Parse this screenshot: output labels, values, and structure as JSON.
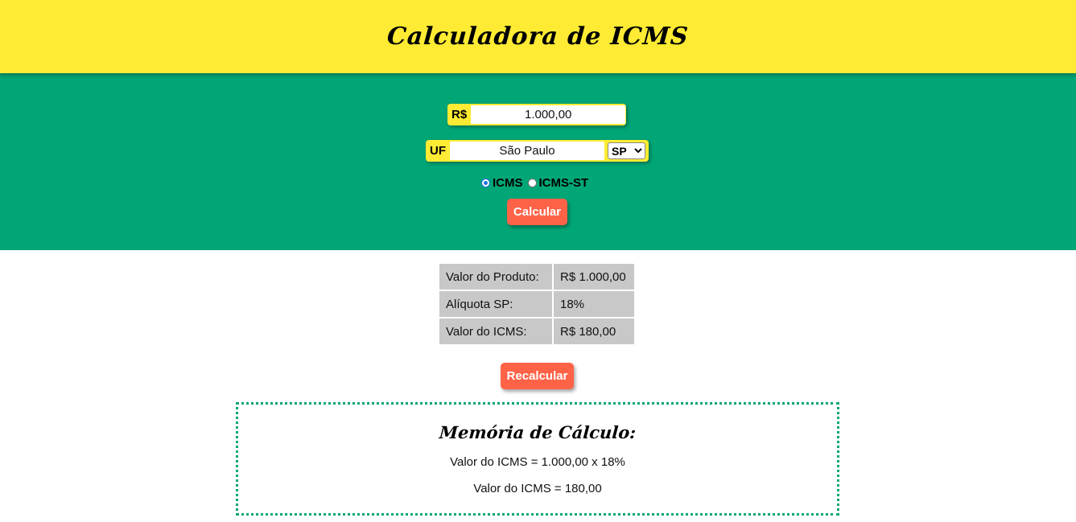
{
  "header": {
    "title": "Calculadora de ICMS"
  },
  "form": {
    "value_prefix": "R$",
    "value": "1.000,00",
    "uf_prefix": "UF",
    "state_name": "São Paulo",
    "uf_selected": "SP",
    "radio_options": [
      {
        "label": "ICMS",
        "checked": true
      },
      {
        "label": "ICMS-ST",
        "checked": false
      }
    ],
    "calc_button": "Calcular"
  },
  "results": {
    "rows": [
      {
        "label": "Valor do Produto:",
        "value": "R$ 1.000,00"
      },
      {
        "label": "Alíquota SP:",
        "value": "18%"
      },
      {
        "label": "Valor do ICMS:",
        "value": "R$ 180,00"
      }
    ],
    "recalc_button": "Recalcular"
  },
  "memo": {
    "title": "Memória de Cálculo:",
    "lines": [
      "Valor do ICMS = 1.000,00 x 18%",
      "Valor do ICMS = 180,00"
    ]
  },
  "colors": {
    "header_bg": "#ffeb33",
    "form_bg": "#00a676",
    "button_bg": "#ff6347",
    "table_cell_bg": "#c8c8c8"
  }
}
